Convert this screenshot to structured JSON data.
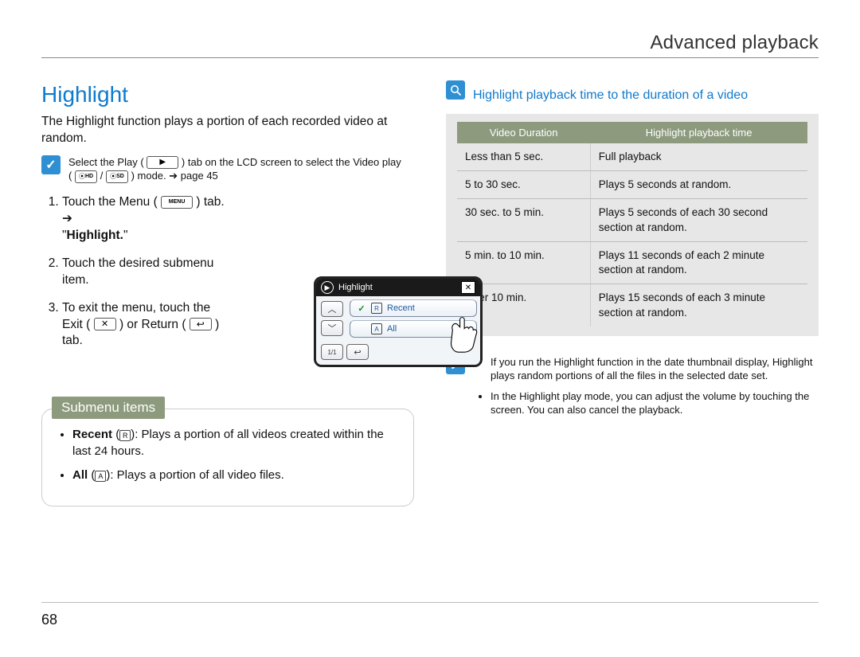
{
  "header": {
    "title": "Advanced playback"
  },
  "page_number": "68",
  "left": {
    "title": "Highlight",
    "lead": "The Highlight function plays a portion of each recorded video at random.",
    "select_note": {
      "line1_a": "Select the Play (",
      "line1_b": ") tab on the LCD screen to select the Video play",
      "line2_a": "(",
      "line2_b": " / ",
      "line2_c": ") mode. ",
      "arrow": "➔",
      "page_ref": "page 45",
      "hd": "HD",
      "sd": "SD"
    },
    "steps": {
      "s1_a": "Touch the Menu (",
      "s1_menu": "MENU",
      "s1_b": ") tab. ",
      "s1_arrow": "➔",
      "s1_q1": "\"",
      "s1_bold": "Highlight.",
      "s1_q2": "\"",
      "s2": "Touch the desired submenu item.",
      "s3_a": "To exit the menu, touch the Exit (",
      "s3_b": ") or Return (",
      "s3_c": ") tab."
    },
    "mock": {
      "title": "Highlight",
      "close": "✕",
      "up": "︿",
      "down": "﹀",
      "pagebadge": "1/1",
      "return": "↩",
      "opt1_badge": "R",
      "opt1_label": "Recent",
      "opt2_badge": "A",
      "opt2_label": "All"
    },
    "submenu": {
      "tab": "Submenu items",
      "recent_label": "Recent",
      "recent_badge": "R",
      "recent_text": ": Plays a portion of all videos created within the last 24 hours.",
      "all_label": "All",
      "all_badge": "A",
      "all_text": ": Plays a portion of all video files."
    }
  },
  "right": {
    "title": "Highlight playback time to the duration of a video",
    "table": {
      "h1": "Video Duration",
      "h2": "Highlight playback time",
      "rows": [
        {
          "c1": "Less than 5 sec.",
          "c2": "Full playback"
        },
        {
          "c1": "5 to 30 sec.",
          "c2": "Plays 5 seconds at random."
        },
        {
          "c1": "30 sec. to 5 min.",
          "c2": "Plays 5 seconds of each 30 second section at random."
        },
        {
          "c1": "5 min. to 10 min.",
          "c2": "Plays 11 seconds of each 2 minute section at random."
        },
        {
          "c1": "Over 10 min.",
          "c2": "Plays 15 seconds of each 3 minute section at random."
        }
      ]
    },
    "notes": {
      "n1": "If you run the Highlight function in the date thumbnail display, Highlight plays random portions of all the files in the selected date set.",
      "n2": "In the Highlight play mode, you can adjust the volume by touching the screen. You can also cancel the playback."
    }
  }
}
